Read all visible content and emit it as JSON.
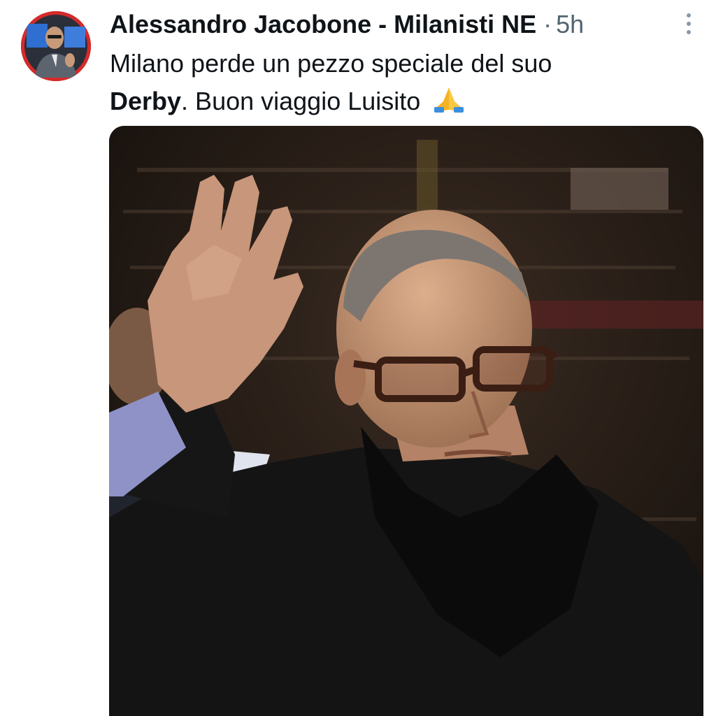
{
  "tweet": {
    "author": {
      "display_name": "Alessandro Jacobone - Milanisti NE",
      "avatar_icon": "profile-photo"
    },
    "separator": "·",
    "timestamp": "5h",
    "text": {
      "line1": "Milano perde un pezzo speciale del suo",
      "bold_word": "Derby",
      "rest": ". Buon viaggio Luisito",
      "emoji_icon": "folded-hands-icon"
    },
    "more_icon": "more-vertical-icon",
    "media": {
      "type": "photo",
      "colors": {
        "background": "#1a1410",
        "coat": "#141414",
        "skin": "#c79a7a"
      }
    }
  },
  "colors": {
    "text_primary": "#0f1419",
    "text_secondary": "#536471",
    "avatar_ring": "#e12a2a"
  }
}
